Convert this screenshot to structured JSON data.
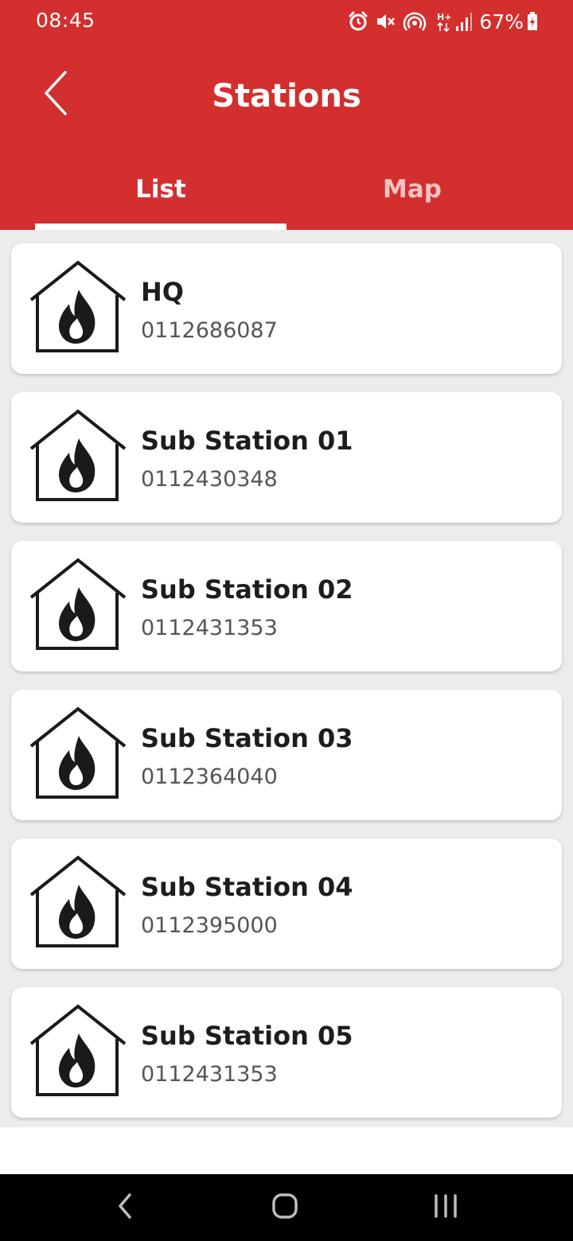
{
  "status_bar": {
    "time": "08:45",
    "battery_percent": "67%",
    "icons": [
      "alarm-icon",
      "mute-icon",
      "hotspot-icon",
      "network-h-plus-icon",
      "signal-icon",
      "battery-icon"
    ]
  },
  "header": {
    "title": "Stations",
    "back_icon": "chevron-left-icon",
    "color": "#d32f2f"
  },
  "tabs": [
    {
      "label": "List",
      "selected": true
    },
    {
      "label": "Map",
      "selected": false
    }
  ],
  "stations": [
    {
      "name": "HQ",
      "phone": "0112686087",
      "icon": "fire-station-icon"
    },
    {
      "name": "Sub Station 01",
      "phone": "0112430348",
      "icon": "fire-station-icon"
    },
    {
      "name": "Sub Station 02",
      "phone": "0112431353",
      "icon": "fire-station-icon"
    },
    {
      "name": "Sub Station 03",
      "phone": "0112364040",
      "icon": "fire-station-icon"
    },
    {
      "name": "Sub Station 04",
      "phone": "0112395000",
      "icon": "fire-station-icon"
    },
    {
      "name": "Sub Station 05",
      "phone": "0112431353",
      "icon": "fire-station-icon"
    }
  ],
  "nav_bar": {
    "buttons": [
      "nav-back-icon",
      "nav-home-icon",
      "nav-recents-icon"
    ]
  }
}
